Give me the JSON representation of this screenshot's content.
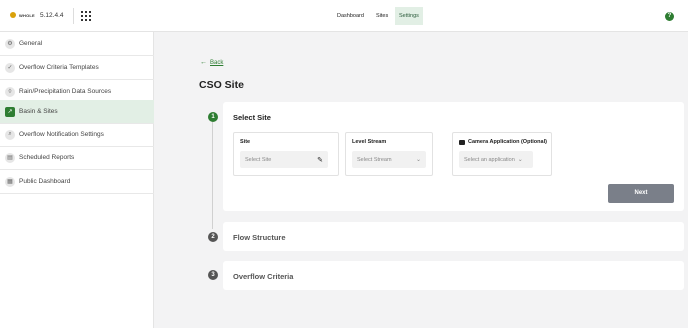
{
  "header": {
    "logo_text": "WHOLE",
    "version": "5.12.4.4",
    "nav": [
      {
        "label": "Dashboard"
      },
      {
        "label": "Sites"
      },
      {
        "label": "Settings"
      }
    ],
    "help_glyph": "?"
  },
  "sidebar": {
    "items": [
      {
        "label": "General",
        "icon": "gear-icon"
      },
      {
        "label": "Overflow Criteria Templates",
        "icon": "checkmark-icon"
      },
      {
        "label": "Rain/Precipitation Data Sources",
        "icon": "raindrop-icon"
      },
      {
        "label": "Basin & Sites",
        "icon": "chart-icon",
        "active": true
      },
      {
        "label": "Overflow Notification Settings",
        "icon": "bell-search-icon"
      },
      {
        "label": "Scheduled Reports",
        "icon": "calendar-icon"
      },
      {
        "label": "Public Dashboard",
        "icon": "dashboard-icon"
      }
    ]
  },
  "main": {
    "back_label": "Back",
    "page_title": "CSO Site",
    "steps": [
      {
        "number": "1",
        "title": "Select Site"
      },
      {
        "number": "2",
        "title": "Flow Structure"
      },
      {
        "number": "3",
        "title": "Overflow Criteria"
      }
    ],
    "fields": {
      "site": {
        "label": "Site",
        "placeholder": "Select Site"
      },
      "level_stream": {
        "label": "Level Stream",
        "placeholder": "Select Stream"
      },
      "camera": {
        "label": "Camera Application (Optional)",
        "placeholder": "Select an application"
      }
    },
    "next_label": "Next"
  },
  "colors": {
    "accent": "#2e7d32",
    "active_bg": "#e2efe5",
    "button_bg": "#7a7f89"
  }
}
